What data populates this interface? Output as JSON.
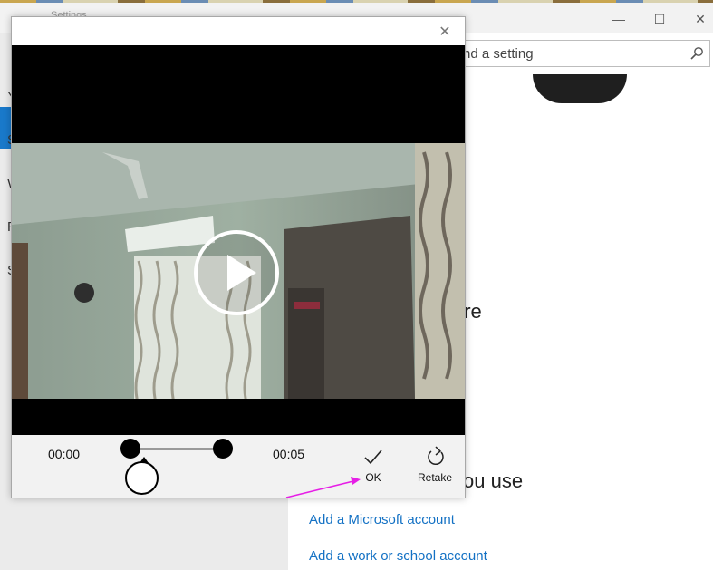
{
  "settings_window": {
    "title": "Settings",
    "controls": {
      "minimize": "—",
      "maximize": "☐",
      "close": "✕"
    },
    "sidebar_letters": [
      "Y",
      "S",
      "W",
      "F",
      "S"
    ],
    "search_placeholder": "nd a setting",
    "heading_picture_fragment": "ure",
    "heading_accounts_fragment": "you use",
    "links": {
      "add_microsoft": "Add a Microsoft account",
      "add_work": "Add a work or school account"
    },
    "accent_color": "#1979ca",
    "link_color": "#1371c4"
  },
  "dialog": {
    "close_glyph": "✕",
    "time_start": "00:00",
    "time_end": "00:05",
    "ok_label": "OK",
    "retake_label": "Retake",
    "icons": {
      "close": "close-icon",
      "play": "play-icon",
      "ok": "checkmark-icon",
      "retake": "retake-icon"
    }
  },
  "annotation": {
    "color": "#e61ee6"
  }
}
